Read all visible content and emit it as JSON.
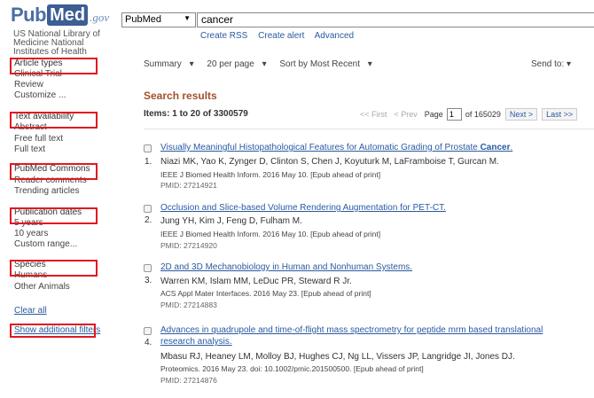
{
  "header": {
    "logo_pub": "Pub",
    "logo_med": "Med",
    "logo_gov": ".gov",
    "org_lines": [
      "US National Library of",
      "Medicine National",
      "Institutes of Health"
    ],
    "database_selected": "PubMed",
    "search_value": "cancer",
    "links": [
      "Create RSS",
      "Create alert",
      "Advanced"
    ]
  },
  "sidebar": {
    "article_types": {
      "heading": "Article types",
      "items": [
        "Clinical Trial",
        "Review",
        "Customize ..."
      ]
    },
    "text_availability": {
      "heading": "Text availability",
      "items": [
        "Abstract",
        "Free full text",
        "Full text"
      ]
    },
    "pubmed_commons": {
      "heading": "PubMed Commons",
      "items": [
        "Reader comments",
        "Trending articles"
      ]
    },
    "publication_dates": {
      "heading": "Publication dates",
      "items": [
        "5 years",
        "10 years",
        "Custom range..."
      ]
    },
    "species": {
      "heading": "Species",
      "items": [
        "Humans",
        "Other Animals"
      ]
    },
    "clear_all": "Clear all",
    "show_filters": "Show additional filters"
  },
  "toolbar": {
    "summary": "Summary",
    "per_page": "20 per page",
    "sort": "Sort by Most Recent",
    "send_to": "Send to:"
  },
  "results": {
    "heading": "Search results",
    "items_count": "Items: 1 to 20 of 3300579",
    "pager": {
      "first": "<< First",
      "prev": "< Prev",
      "page_label": "Page",
      "page_value": "1",
      "of_pages": "of 165029",
      "next": "Next >",
      "last": "Last >>"
    },
    "list": [
      {
        "num": "1.",
        "title": "Visually Meaningful Histopathological Features for Automatic Grading of Prostate",
        "title_bold": "Cancer",
        "title_end": ".",
        "authors": "Niazi MK, Yao K, Zynger D, Clinton S, Chen J, Koyuturk M, LaFramboise T, Gurcan M.",
        "journal": "IEEE J Biomed Health Inform. 2016 May 10. [Epub ahead of print]",
        "pmid": "PMID: 27214921"
      },
      {
        "num": "2.",
        "title": "Occlusion and Slice-based Volume Rendering Augmentation for PET-CT.",
        "authors": "Jung YH, Kim J, Feng D, Fulham M.",
        "journal": "IEEE J Biomed Health Inform. 2016 May 10. [Epub ahead of print]",
        "pmid": "PMID: 27214920"
      },
      {
        "num": "3.",
        "title": "2D and 3D Mechanobiology in Human and Nonhuman Systems.",
        "authors": "Warren KM, Islam MM, LeDuc PR, Steward R Jr.",
        "journal": "ACS Appl Mater Interfaces. 2016 May 23. [Epub ahead of print]",
        "pmid": "PMID: 27214883"
      },
      {
        "num": "4.",
        "title": "Advances in quadrupole and time-of-flight mass spectrometry for peptide mrm based translational",
        "title_line2": "research analysis.",
        "authors": "Mbasu RJ, Heaney LM, Molloy BJ, Hughes CJ, Ng LL, Vissers JP, Langridge JI, Jones DJ.",
        "journal": "Proteomics. 2016 May 23. doi: 10.1002/pmic.201500500. [Epub ahead of print]",
        "pmid": "PMID: 27214876"
      }
    ]
  },
  "colors": {
    "link": "#2a5aa0",
    "heading_accent": "#a0522d",
    "annotation_box": "#e0191f",
    "logo_blue": "#3c5e95"
  }
}
